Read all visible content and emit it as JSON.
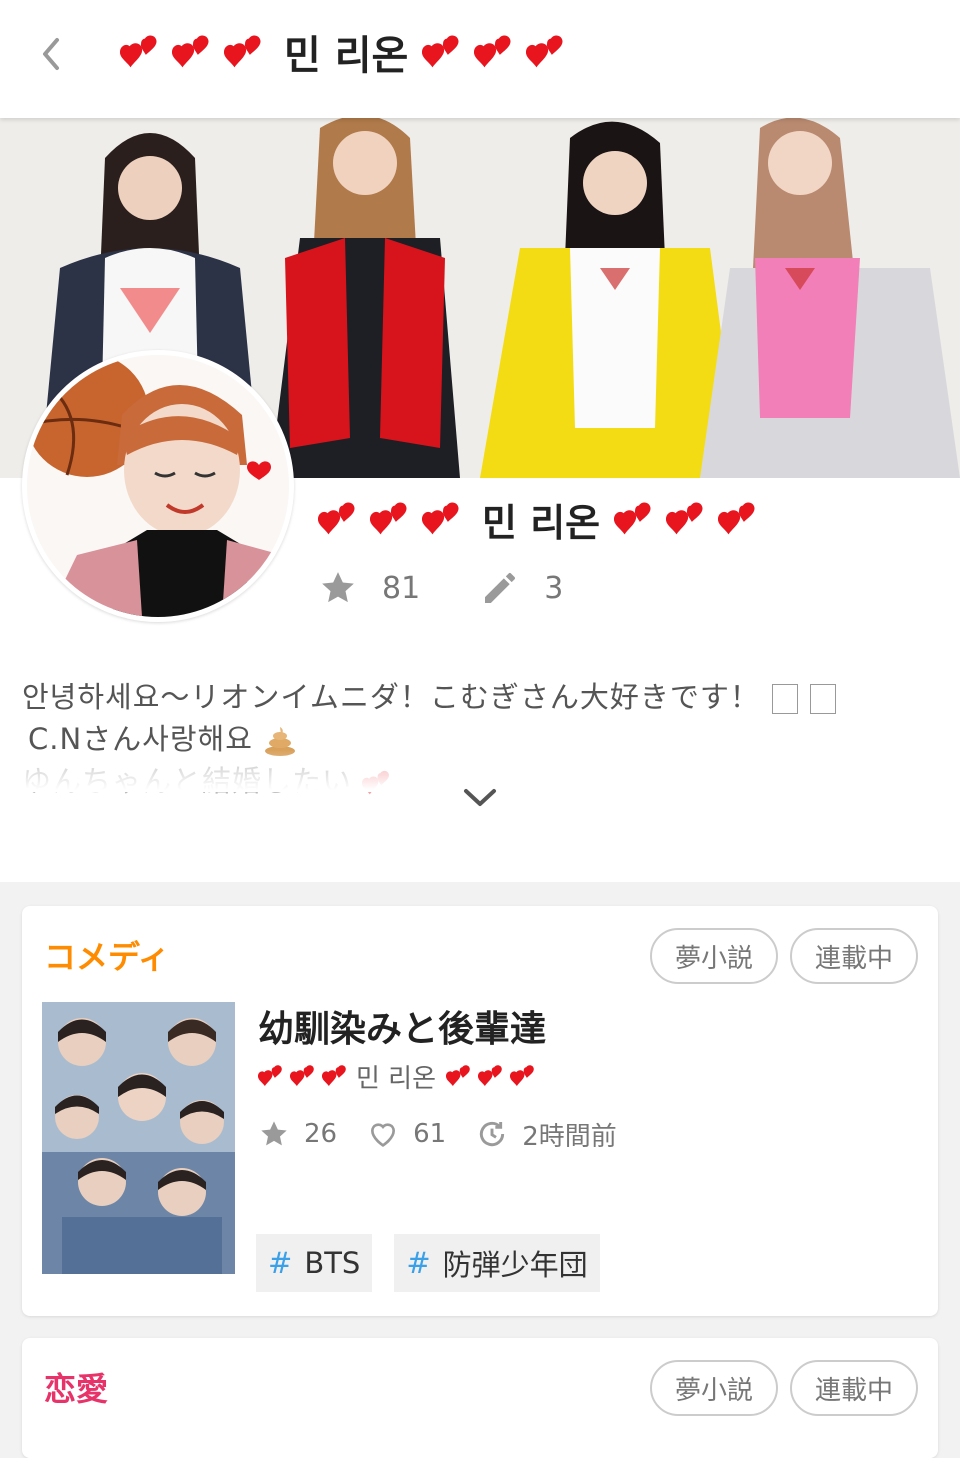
{
  "header": {
    "title": "민 리온"
  },
  "profile": {
    "name": "민 리온",
    "stars": "81",
    "posts": "3",
    "bio_lines": [
      "안녕하세요〜リオンイムニダ！こむぎさん大好きです！",
      "C.Nさん사랑해요",
      "ゆんちゃんと結婚したい"
    ]
  },
  "stories": [
    {
      "genre": "コメディ",
      "genre_color": "#ff8c00",
      "badge_type": "夢小説",
      "badge_status": "連載中",
      "title": "幼馴染みと後輩達",
      "author": "민 리온",
      "stars": "26",
      "likes": "61",
      "updated": "2時間前",
      "tags": [
        "BTS",
        "防弾少年団"
      ]
    },
    {
      "genre": "恋愛",
      "genre_color": "#e8336a",
      "badge_type": "夢小説",
      "badge_status": "連載中"
    }
  ],
  "colors": {
    "heart": "#e8141e",
    "tag_hash": "#3aa0e8"
  }
}
